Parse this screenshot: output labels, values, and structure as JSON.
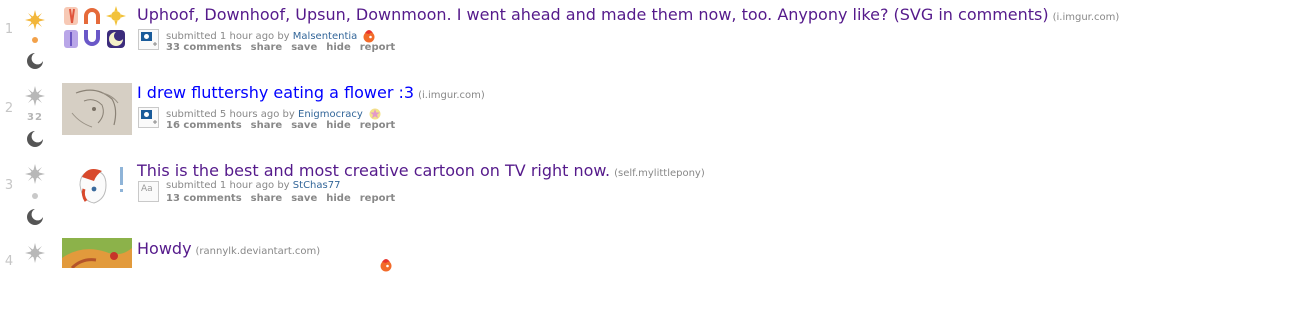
{
  "colors": {
    "visited": "#551a8b",
    "unvisited": "#0000ff",
    "author": "#336699",
    "meta": "#888888",
    "rank": "#c6c6c6"
  },
  "posts": [
    {
      "rank": "1",
      "score": "",
      "title": "Uphoof, Downhoof, Upsun, Downmoon. I went ahead and made them now, too. Anypony like? (SVG in comments)",
      "domain": "(i.imgur.com)",
      "submitted": "submitted 1 hour ago by",
      "author": "Malsententia",
      "comments": "33 comments",
      "share": "share",
      "save": "save",
      "hide": "hide",
      "report": "report",
      "thumb_icon": "horseshoe-sun-moon-icons",
      "expando_icon": "image-expando-icon",
      "flair_icon": "fire-pony-flair-icon"
    },
    {
      "rank": "2",
      "score": "32",
      "title": "I drew fluttershy eating a flower :3",
      "domain": "(i.imgur.com)",
      "submitted": "submitted 5 hours ago by",
      "author": "Enigmocracy",
      "comments": "16 comments",
      "share": "share",
      "save": "save",
      "hide": "hide",
      "report": "report",
      "thumb_icon": "sketch-thumbnail",
      "expando_icon": "image-expando-icon",
      "flair_icon": "star-pony-flair-icon"
    },
    {
      "rank": "3",
      "score": "",
      "title": "This is the best and most creative cartoon on TV right now.",
      "domain": "(self.mylittlepony)",
      "submitted": "submitted 1 hour ago by",
      "author": "StChas77",
      "comments": "13 comments",
      "share": "share",
      "save": "save",
      "hide": "hide",
      "report": "report",
      "thumb_icon": "pony-exclaim-thumbnail",
      "expando_icon": "text-expando-icon",
      "expando_text": "Aa",
      "flair_icon": ""
    },
    {
      "rank": "4",
      "score": "",
      "title": "Howdy",
      "domain": "(rannylk.deviantart.com)",
      "submitted": "",
      "author": "",
      "comments": "",
      "thumb_icon": "applejack-painting-thumbnail",
      "flair_icon": "fire-pony-flair-icon"
    }
  ]
}
